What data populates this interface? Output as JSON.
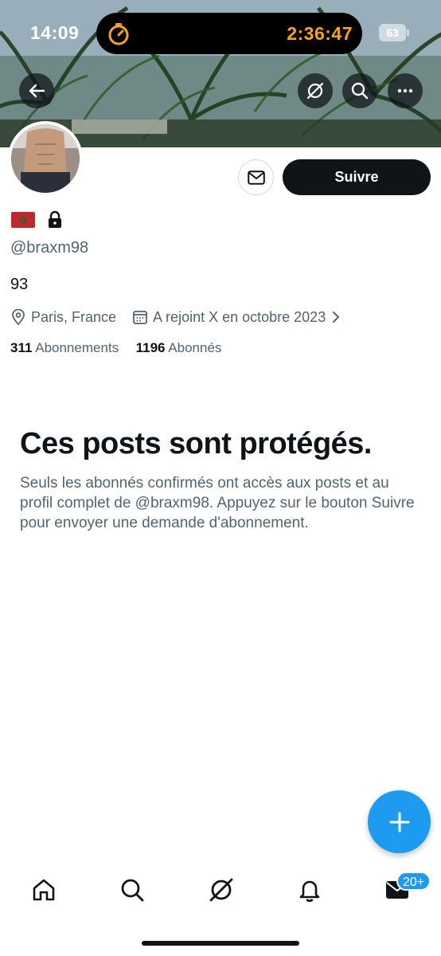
{
  "status_bar": {
    "time": "14:09",
    "timer": "2:36:47",
    "battery": "63",
    "icons": [
      "stopwatch-icon",
      "battery-icon"
    ]
  },
  "header": {
    "icons": [
      "back-arrow-icon",
      "grok-icon",
      "search-icon",
      "more-icon"
    ]
  },
  "profile": {
    "emoji_flag": "🇲🇦",
    "handle": "@braxm98",
    "bio": "93",
    "location": "Paris, France",
    "joined": "A rejoint X en octobre 2023",
    "following_count": "311",
    "following_label": "Abonnements",
    "followers_count": "1196",
    "followers_label": "Abonnés",
    "follow_button": "Suivre"
  },
  "protected": {
    "title": "Ces posts sont protégés.",
    "message": "Seuls les abonnés confirmés ont accès aux posts et au profil complet de @braxm98. Appuyez sur le bouton Suivre pour envoyer une demande d'abonnement."
  },
  "tab_bar": {
    "items": [
      "home-icon",
      "search-icon",
      "grok-icon",
      "notifications-icon",
      "messages-icon"
    ],
    "messages_badge": "20+"
  },
  "colors": {
    "accent": "#1d9bf0",
    "timer": "#f7a31c",
    "text_primary": "#0f1419",
    "text_secondary": "#536471"
  }
}
